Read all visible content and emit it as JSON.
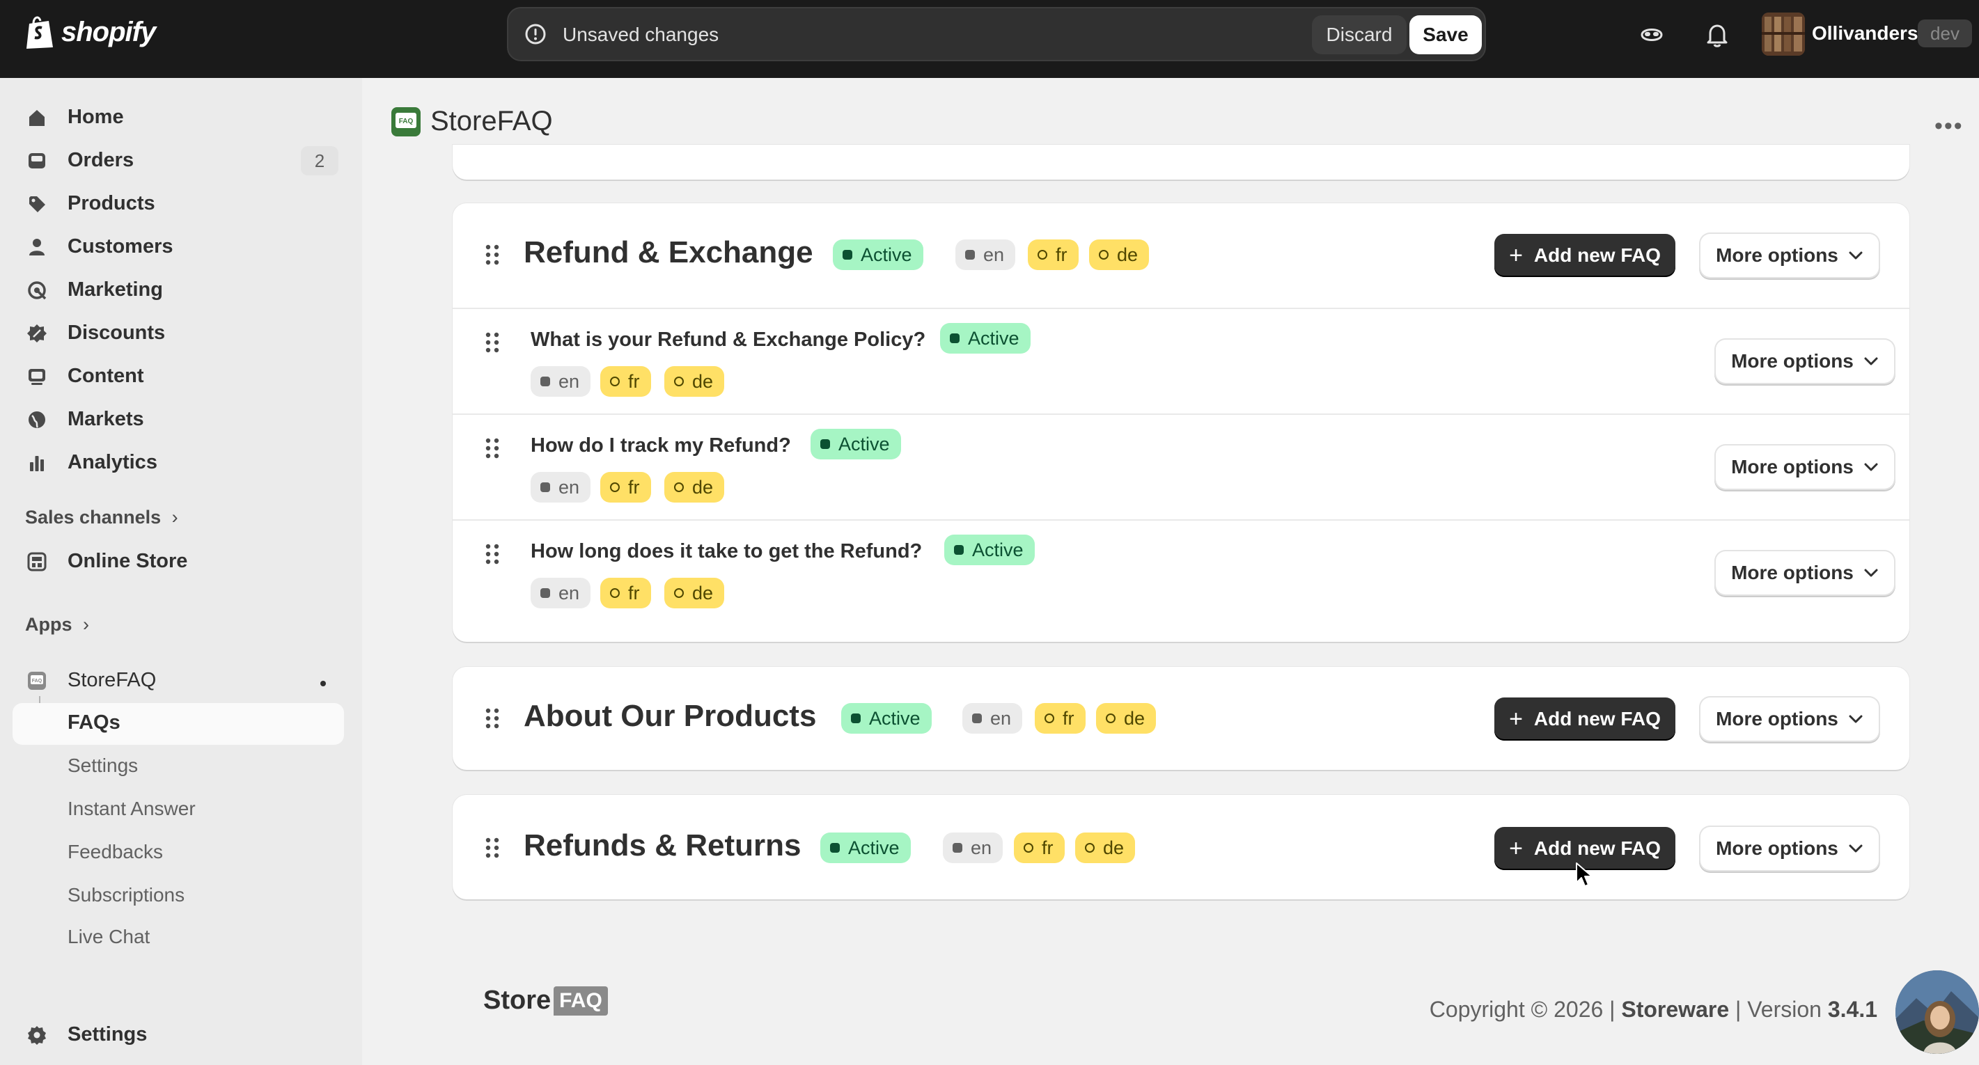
{
  "topbar": {
    "brand": "shopify",
    "unsaved_text": "Unsaved changes",
    "discard_label": "Discard",
    "save_label": "Save",
    "store_name": "Ollivanders",
    "store_badge": "dev"
  },
  "sidebar": {
    "items": [
      {
        "label": "Home",
        "icon": "home-icon"
      },
      {
        "label": "Orders",
        "icon": "orders-icon",
        "count": "2"
      },
      {
        "label": "Products",
        "icon": "tag-icon"
      },
      {
        "label": "Customers",
        "icon": "person-icon"
      },
      {
        "label": "Marketing",
        "icon": "target-icon"
      },
      {
        "label": "Discounts",
        "icon": "discount-icon"
      },
      {
        "label": "Content",
        "icon": "content-icon"
      },
      {
        "label": "Markets",
        "icon": "globe-icon"
      },
      {
        "label": "Analytics",
        "icon": "chart-icon"
      }
    ],
    "sales_channels_label": "Sales channels",
    "online_store_label": "Online Store",
    "apps_label": "Apps",
    "app_name": "StoreFAQ",
    "app_subitems": [
      "FAQs",
      "Settings",
      "Instant Answer",
      "Feedbacks",
      "Subscriptions",
      "Live Chat"
    ],
    "settings_label": "Settings"
  },
  "app": {
    "title": "StoreFAQ"
  },
  "languages": {
    "en": "en",
    "fr": "fr",
    "de": "de"
  },
  "status_active": "Active",
  "add_faq_label": "Add new FAQ",
  "more_options_label": "More options",
  "groups": [
    {
      "title": "Refund & Exchange",
      "faqs": [
        {
          "question": "What is your Refund & Exchange Policy?"
        },
        {
          "question": "How do I track my Refund?"
        },
        {
          "question": "How long does it take to get the Refund?"
        }
      ]
    },
    {
      "title": "About Our Products"
    },
    {
      "title": "Refunds & Returns"
    }
  ],
  "footer": {
    "logo_store": "Store",
    "logo_faq": "FAQ",
    "copyright": "Copyright © 2026 |",
    "company": "Storeware",
    "version_label": "| Version",
    "version": "3.4.1"
  }
}
